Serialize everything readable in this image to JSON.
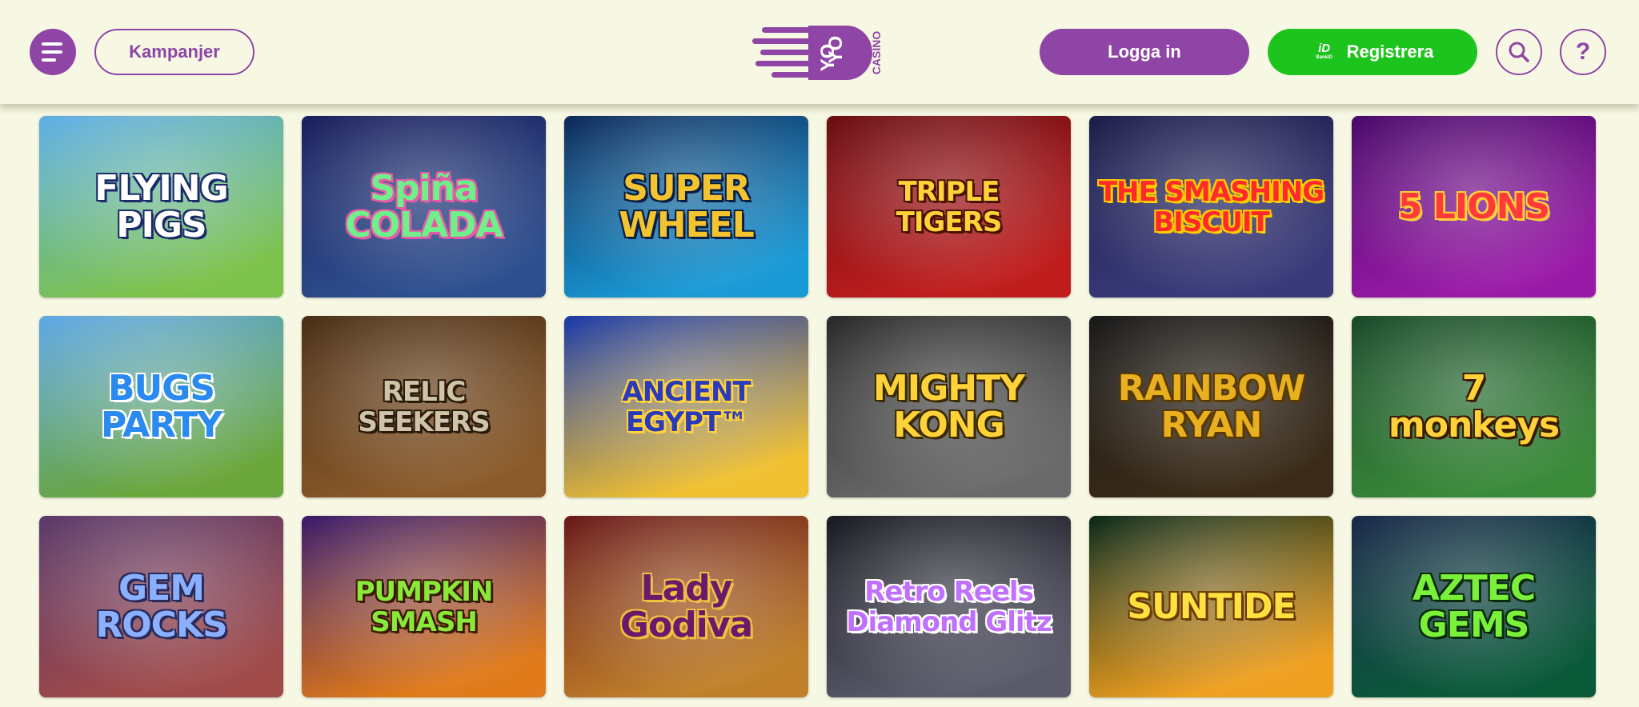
{
  "header": {
    "menu_icon": "hamburger-menu-icon",
    "campaigns_label": "Kampanjer",
    "logo": {
      "text_top": "YO",
      "text_bottom": "YO",
      "text_side": "CASINO",
      "color": "#8f45a5"
    },
    "login_label": "Logga in",
    "register_label": "Registrera",
    "bankid_mark": "iD",
    "bankid_label": "BankID",
    "search_icon": "search-icon",
    "help_icon": "question-mark-icon",
    "help_glyph": "?"
  },
  "colors": {
    "brand": "#8f45a5",
    "register": "#1ec41e",
    "background": "#f7f8e4"
  },
  "games": [
    {
      "title": "FLYING\nPIGS",
      "bg1": "#5eaee8",
      "bg2": "#7cc24a",
      "fg": "#ffffff",
      "stroke": "#1b2b6a"
    },
    {
      "title": "Spiña\nCOLADA",
      "bg1": "#1a1f5c",
      "bg2": "#2e4f8f",
      "fg": "#6ff08a",
      "stroke": "#e85aa8"
    },
    {
      "title": "SUPER\nWHEEL",
      "bg1": "#0e2a5a",
      "bg2": "#1a9ad6",
      "fg": "#f4c430",
      "stroke": "#0b1e44"
    },
    {
      "title": "TRIPLE\nTIGERS",
      "bg1": "#6a0e14",
      "bg2": "#c01d1d",
      "fg": "#ffd23a",
      "stroke": "#4a1100"
    },
    {
      "title": "THE SMASHING\nBISCUIT",
      "bg1": "#1c1e4a",
      "bg2": "#3a3a7a",
      "fg": "#ff2a2a",
      "stroke": "#ffcc00"
    },
    {
      "title": "5 LIONS",
      "bg1": "#4a0a6a",
      "bg2": "#9a1aa8",
      "fg": "#ff3a3a",
      "stroke": "#ffd23a"
    },
    {
      "title": "BUGS\nPARTY",
      "bg1": "#5fa8e6",
      "bg2": "#6aa63a",
      "fg": "#2a8af0",
      "stroke": "#ffffff"
    },
    {
      "title": "RELIC\nSEEKERS",
      "bg1": "#4a2e16",
      "bg2": "#8a5a2a",
      "fg": "#cfc4a8",
      "stroke": "#2a1a0a"
    },
    {
      "title": "ANCIENT\nEGYPT™",
      "bg1": "#1a3aa8",
      "bg2": "#f0c030",
      "fg": "#2a3ab8",
      "stroke": "#ffd23a"
    },
    {
      "title": "MIGHTY KONG",
      "bg1": "#2a2a2a",
      "bg2": "#6a6a6a",
      "fg": "#ffd23a",
      "stroke": "#3a2a00"
    },
    {
      "title": "RAINBOW\nRYAN",
      "bg1": "#1a1a1a",
      "bg2": "#3a2a18",
      "fg": "#e8b020",
      "stroke": "#5a3a00"
    },
    {
      "title": "7\nmonkeys",
      "bg1": "#1a4a2a",
      "bg2": "#3a8a3a",
      "fg": "#ffd23a",
      "stroke": "#3a1a00"
    },
    {
      "title": "GEM\nROCKS",
      "bg1": "#5a3a6a",
      "bg2": "#a04a4a",
      "fg": "#8ab0ff",
      "stroke": "#2a2a5a"
    },
    {
      "title": "PUMPKIN\nSMASH",
      "bg1": "#3a1a6a",
      "bg2": "#e07a1a",
      "fg": "#8ae83a",
      "stroke": "#3a1a00"
    },
    {
      "title": "Lady Godiva",
      "bg1": "#6a1a1a",
      "bg2": "#c0802a",
      "fg": "#6a1a6a",
      "stroke": "#f0c040"
    },
    {
      "title": "Retro Reels\nDiamond Glitz",
      "bg1": "#1a1a22",
      "bg2": "#5a5a6a",
      "fg": "#c070ff",
      "stroke": "#ffffff"
    },
    {
      "title": "SUNTIDE",
      "bg1": "#0a2a1a",
      "bg2": "#f0a020",
      "fg": "#ffe040",
      "stroke": "#6a3a00"
    },
    {
      "title": "AZTEC GEMS",
      "bg1": "#1a2a4a",
      "bg2": "#0a5a3a",
      "fg": "#7af03a",
      "stroke": "#0a2a0a"
    }
  ]
}
